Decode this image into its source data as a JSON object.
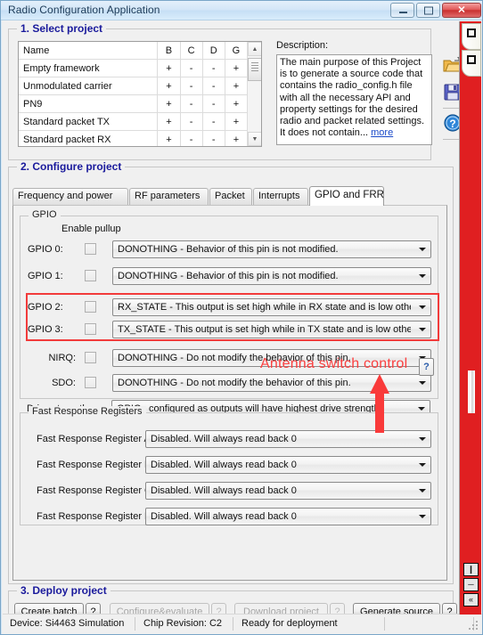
{
  "window": {
    "title": "Radio Configuration Application",
    "buttons": {
      "minimize": "minimize-button",
      "maximize": "maximize-button",
      "close_glyph": "✕"
    }
  },
  "section1": {
    "legend": "1. Select project",
    "table": {
      "headers": [
        "Name",
        "B",
        "C",
        "D",
        "G"
      ],
      "rows": [
        {
          "name": "Empty framework",
          "b": "+",
          "c": "-",
          "d": "-",
          "g": "+"
        },
        {
          "name": "Unmodulated carrier",
          "b": "+",
          "c": "-",
          "d": "-",
          "g": "+"
        },
        {
          "name": "PN9",
          "b": "+",
          "c": "-",
          "d": "-",
          "g": "+"
        },
        {
          "name": "Standard packet TX",
          "b": "+",
          "c": "-",
          "d": "-",
          "g": "+"
        },
        {
          "name": "Standard packet RX",
          "b": "+",
          "c": "-",
          "d": "-",
          "g": "+"
        }
      ]
    },
    "description_label": "Description:",
    "description_text": "The main purpose of this Project is to generate a source code that contains the radio_config.h file with all the necessary API and property settings for the desired radio and packet related settings. It does not contain...",
    "description_more": "more",
    "toolbar_icons": [
      "open-project-icon",
      "save-project-icon",
      "help-icon"
    ]
  },
  "section2": {
    "legend": "2. Configure project",
    "tabs": [
      {
        "label": "Frequency and power",
        "active": false
      },
      {
        "label": "RF parameters",
        "active": false
      },
      {
        "label": "Packet",
        "active": false
      },
      {
        "label": "Interrupts",
        "active": false
      },
      {
        "label": "GPIO and FRR",
        "active": true
      }
    ],
    "gpio": {
      "legend": "GPIO",
      "enable_pullup_label": "Enable pullup",
      "help_button": "?",
      "rows": [
        {
          "label": "GPIO 0:",
          "checked": false,
          "value": "DONOTHING - Behavior of this pin is not modified."
        },
        {
          "label": "GPIO 1:",
          "checked": false,
          "value": "DONOTHING - Behavior of this pin is not modified."
        },
        {
          "label": "GPIO 2:",
          "checked": false,
          "value": "RX_STATE - This output is set high while in RX state and is low otherwi"
        },
        {
          "label": "GPIO 3:",
          "checked": false,
          "value": "TX_STATE - This output is set high while in TX state and is low otherwi"
        },
        {
          "label": "NIRQ:",
          "checked": false,
          "value": "DONOTHING - Do not modify the behavior of this pin."
        },
        {
          "label": "SDO:",
          "checked": false,
          "value": "DONOTHING - Do not modify the behavior of this pin."
        }
      ],
      "drive_strength_label": "Drive strength:",
      "drive_strength_value": "GPIOs configured as outputs will have highest drive strength."
    },
    "frr": {
      "legend": "Fast Response Registers",
      "rows": [
        {
          "label": "Fast Response Register A:",
          "value": "Disabled. Will always read back 0"
        },
        {
          "label": "Fast Response Register B:",
          "value": "Disabled. Will always read back 0"
        },
        {
          "label": "Fast Response Register C:",
          "value": "Disabled. Will always read back 0"
        },
        {
          "label": "Fast Response Register D:",
          "value": "Disabled. Will always read back 0"
        }
      ]
    },
    "annotation": {
      "text": "Antenna switch control",
      "color": "#fb4040"
    }
  },
  "section3": {
    "legend": "3. Deploy project",
    "buttons": [
      {
        "label": "Create batch",
        "help": "?",
        "disabled": false
      },
      {
        "label": "Configure&evaluate",
        "help": "?",
        "disabled": true
      },
      {
        "label": "Download project",
        "help": "?",
        "disabled": true
      },
      {
        "label": "Generate source",
        "help": "?",
        "disabled": false
      }
    ]
  },
  "statusbar": {
    "device": "Device: Si4463  Simulation",
    "chip_revision": "Chip Revision: C2",
    "state": "Ready for deployment"
  },
  "right_panel": {
    "color": "#e01f21",
    "buttons": [
      "restore-panel-button",
      "minimize-panel-button",
      "collapse-panel-button"
    ],
    "button_glyphs": [
      "❙",
      "─",
      "«"
    ]
  }
}
